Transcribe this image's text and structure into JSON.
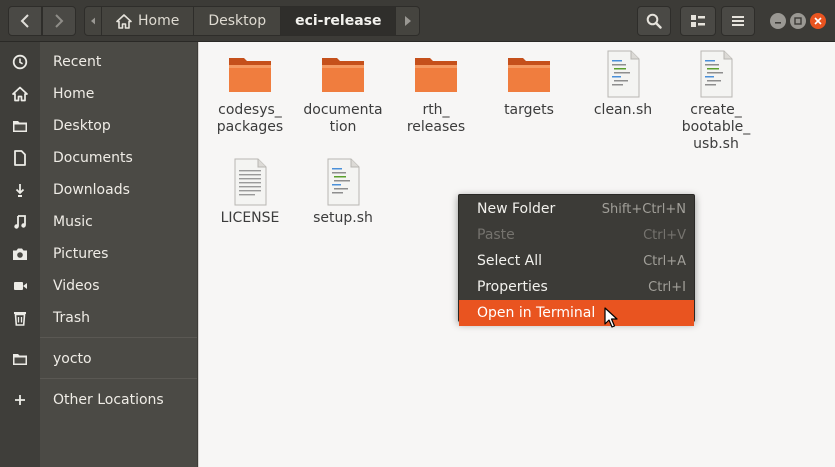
{
  "header": {
    "path": [
      {
        "label": "Home",
        "icon": "home-icon"
      },
      {
        "label": "Desktop"
      },
      {
        "label": "eci-release",
        "current": true
      }
    ]
  },
  "sidebar": {
    "items": [
      {
        "label": "Recent",
        "icon": "clock-icon"
      },
      {
        "label": "Home",
        "icon": "home-icon"
      },
      {
        "label": "Desktop",
        "icon": "folder-icon"
      },
      {
        "label": "Documents",
        "icon": "document-icon"
      },
      {
        "label": "Downloads",
        "icon": "download-icon"
      },
      {
        "label": "Music",
        "icon": "music-icon"
      },
      {
        "label": "Pictures",
        "icon": "camera-icon"
      },
      {
        "label": "Videos",
        "icon": "video-icon"
      },
      {
        "label": "Trash",
        "icon": "trash-icon"
      },
      {
        "label": "yocto",
        "icon": "folder-icon"
      },
      {
        "label": "Other Locations",
        "icon": "plus-icon"
      }
    ]
  },
  "files": [
    {
      "label": "codesys_\npackages",
      "type": "folder"
    },
    {
      "label": "documenta\ntion",
      "type": "folder"
    },
    {
      "label": "rth_\nreleases",
      "type": "folder"
    },
    {
      "label": "targets",
      "type": "folder"
    },
    {
      "label": "clean.sh",
      "type": "script"
    },
    {
      "label": "create_\nbootable_\nusb.sh",
      "type": "script"
    },
    {
      "label": "LICENSE",
      "type": "text"
    },
    {
      "label": "setup.sh",
      "type": "script"
    }
  ],
  "context_menu": {
    "items": [
      {
        "label": "New Folder",
        "accel": "Shift+Ctrl+N",
        "enabled": true
      },
      {
        "label": "Paste",
        "accel": "Ctrl+V",
        "enabled": false
      },
      {
        "label": "Select All",
        "accel": "Ctrl+A",
        "enabled": true
      },
      {
        "label": "Properties",
        "accel": "Ctrl+I",
        "enabled": true
      },
      {
        "label": "Open in Terminal",
        "accel": "",
        "enabled": true,
        "highlighted": true
      }
    ]
  },
  "colors": {
    "accent": "#e95420",
    "folder": "#f07d3e",
    "sidebar_bg": "#4b4a45",
    "header_bg": "#3c3b37"
  }
}
